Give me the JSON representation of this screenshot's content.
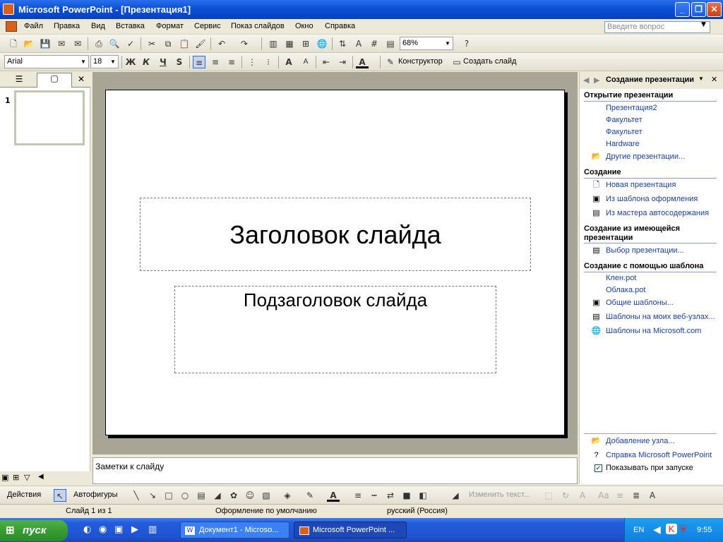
{
  "window": {
    "title": "Microsoft PowerPoint - [Презентация1]"
  },
  "menu": [
    "Файл",
    "Правка",
    "Вид",
    "Вставка",
    "Формат",
    "Сервис",
    "Показ слайдов",
    "Окно",
    "Справка"
  ],
  "ask_placeholder": "Введите вопрос",
  "toolbar": {
    "zoom": "68%",
    "font": "Arial",
    "size": "18",
    "bold": "Ж",
    "italic": "К",
    "underline": "Ч",
    "shadow": "S",
    "designer": "Конструктор",
    "new_slide": "Создать слайд"
  },
  "slides_pane": {
    "slide_number": "1"
  },
  "slide": {
    "title": "Заголовок слайда",
    "subtitle": "Подзаголовок слайда"
  },
  "notes": "Заметки к слайду",
  "taskpane": {
    "title": "Создание презентации",
    "open_header": "Открытие презентации",
    "recent": [
      "Презентация2",
      "Факультет",
      "Факультет",
      "Hardware"
    ],
    "more": "Другие презентации...",
    "create_header": "Создание",
    "create_items": [
      "Новая презентация",
      "Из шаблона оформления",
      "Из мастера автосодержания"
    ],
    "existing_header": "Создание из имеющейся презентации",
    "existing_items": [
      "Выбор презентации..."
    ],
    "template_header": "Создание с помощью шаблона",
    "template_items": [
      "Клен.pot",
      "Облака.pot"
    ],
    "template_links": [
      "Общие шаблоны...",
      "Шаблоны на моих веб-узлах...",
      "Шаблоны на Microsoft.com"
    ],
    "footer": [
      "Добавление узла...",
      "Справка Microsoft PowerPoint"
    ],
    "show_on_start": "Показывать при запуске"
  },
  "drawbar": {
    "actions": "Действия",
    "autoshapes": "Автофигуры",
    "edit_text": "Изменить текст..."
  },
  "status": {
    "slide": "Слайд 1 из 1",
    "design": "Оформление по умолчанию",
    "lang": "русский (Россия)"
  },
  "taskbar": {
    "start": "пуск",
    "tasks": [
      "Документ1 - Microso...",
      "Microsoft PowerPoint ..."
    ],
    "lang": "EN",
    "time": "9:55"
  }
}
